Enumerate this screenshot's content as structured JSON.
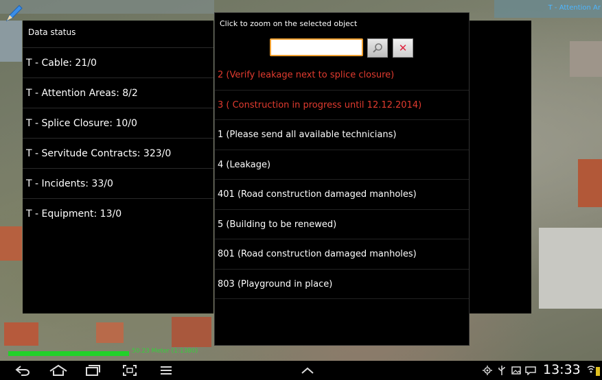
{
  "map": {
    "corner_label": "T - Attention Ar"
  },
  "data_status": {
    "title": "Data status",
    "items": [
      {
        "label": "T - Cable: 21/0"
      },
      {
        "label": "T - Attention Areas: 8/2"
      },
      {
        "label": "T - Splice Closure: 10/0"
      },
      {
        "label": "T - Servitude Contracts: 323/0"
      },
      {
        "label": "T - Incidents: 33/0"
      },
      {
        "label": "T - Equipment: 13/0"
      }
    ]
  },
  "search_dialog": {
    "title": "Click to zoom on the selected object",
    "input_value": "",
    "search_button_icon": "magnifier-icon",
    "clear_button_label": "✕",
    "results": [
      {
        "label": "2 (Verify leakage next to splice closure)",
        "alert": true
      },
      {
        "label": "3 ( Construction in progress until 12.12.2014)",
        "alert": true
      },
      {
        "label": "1 (Please send all available technicians)",
        "alert": false
      },
      {
        "label": "4 (Leakage)",
        "alert": false
      },
      {
        "label": "401 (Road construction damaged manholes)",
        "alert": false
      },
      {
        "label": "5 (Building to be renewed)",
        "alert": false
      },
      {
        "label": "801 (Road construction damaged manholes)",
        "alert": false
      },
      {
        "label": "803 (Playground in place)",
        "alert": false
      }
    ]
  },
  "scale": {
    "label": "50.23 Meter (1:1380)"
  },
  "status_bar": {
    "time": "13:33"
  },
  "colors": {
    "alert": "#e23b2f",
    "accent": "#f0a030",
    "scale": "#22d12a",
    "link": "#4db6ff"
  }
}
